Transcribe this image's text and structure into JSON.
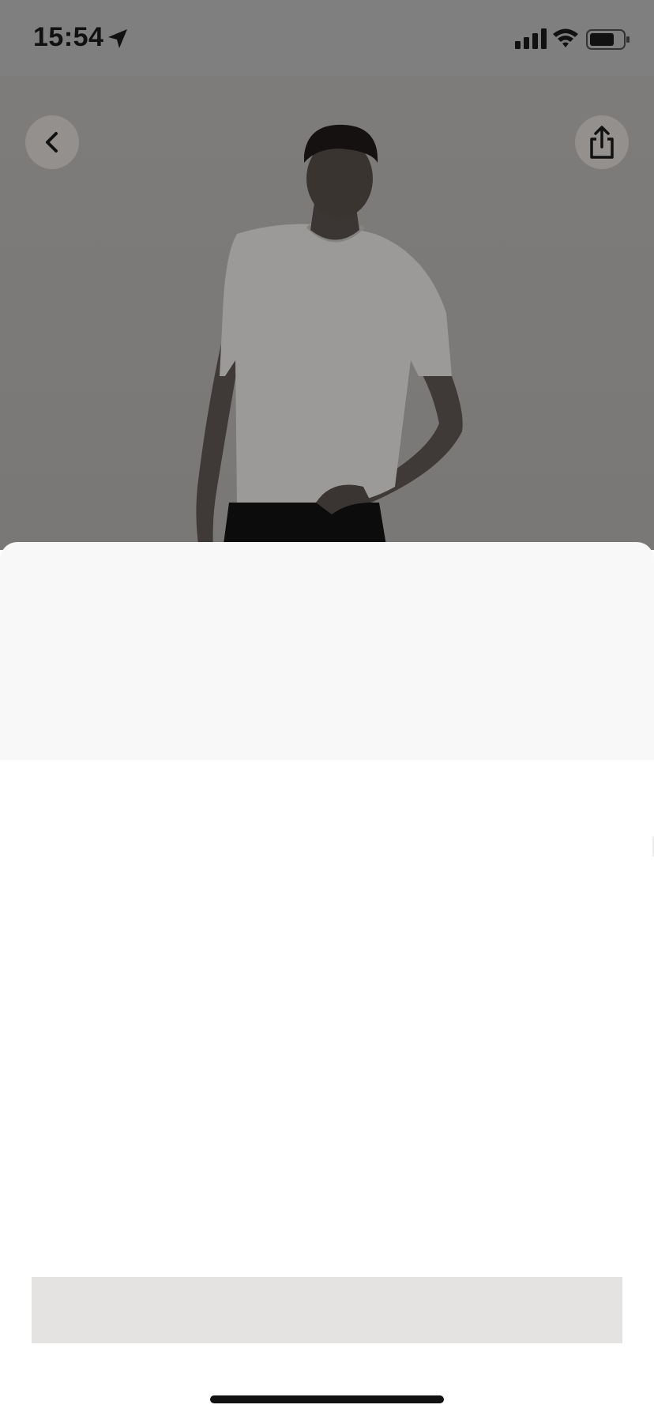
{
  "status_bar": {
    "time": "15:54",
    "icons": [
      "location-arrow-icon",
      "cellular-signal-icon",
      "wifi-icon",
      "battery-icon"
    ]
  },
  "header": {
    "back_icon": "chevron-left-icon",
    "share_icon": "share-icon"
  },
  "hero": {
    "description_hidden": ""
  },
  "colors": {
    "overlay": "#7f7f7f",
    "sheet_top": "#f8f8f8",
    "sheet_body": "#ffffff",
    "cta_placeholder": "#e4e3e2",
    "home_indicator": "#111111"
  }
}
